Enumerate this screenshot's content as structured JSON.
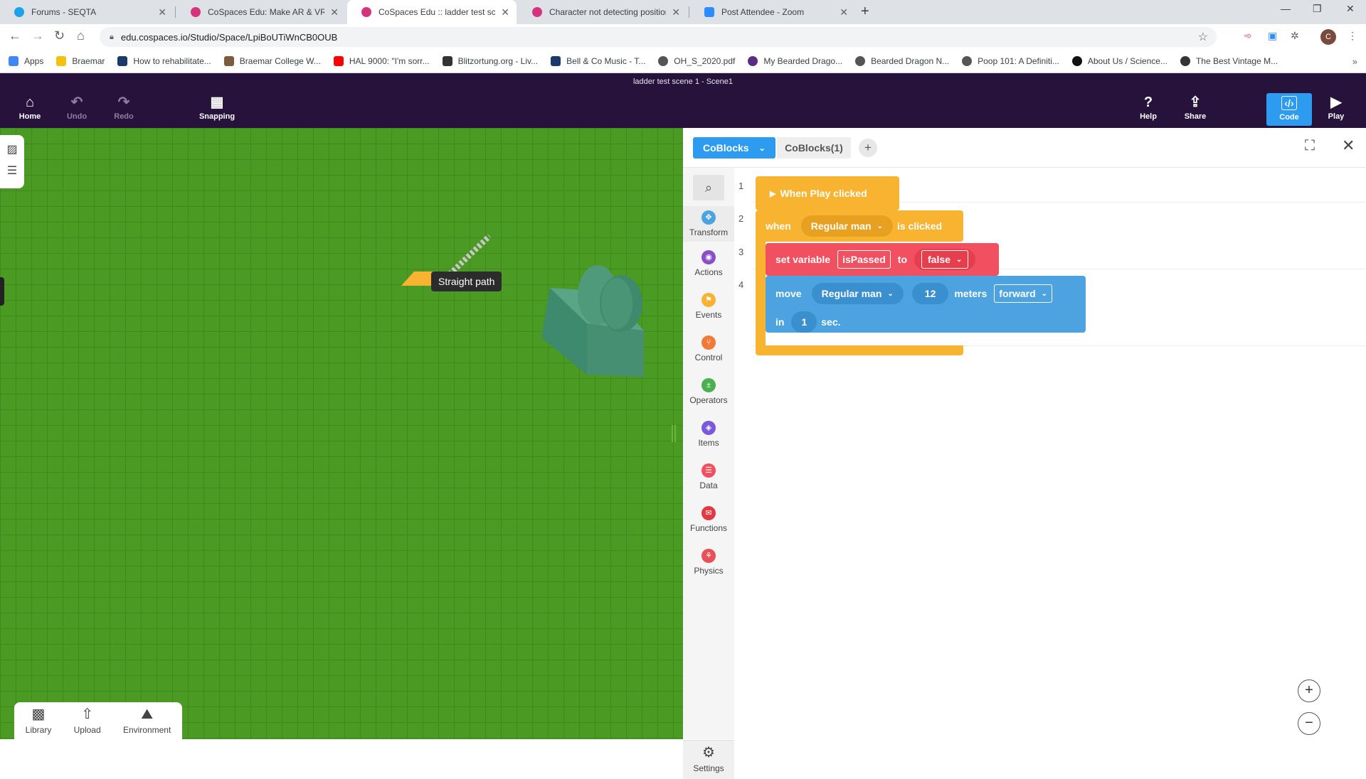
{
  "browser": {
    "tabs": [
      {
        "title": "Forums - SEQTA",
        "color": "#1aa3e8"
      },
      {
        "title": "CoSpaces Edu: Make AR & VR in",
        "color": "#d6337c"
      },
      {
        "title": "CoSpaces Edu :: ladder test scene",
        "color": "#d6337c"
      },
      {
        "title": "Character not detecting position",
        "color": "#d6337c"
      },
      {
        "title": "Post Attendee - Zoom",
        "color": "#2d8cff"
      }
    ],
    "url": "edu.cospaces.io/Studio/Space/LpiBoUTiWnCB0OUB",
    "avatar_letter": "C",
    "bookmarks": [
      {
        "label": "Apps",
        "color": "#4285f4"
      },
      {
        "label": "Braemar",
        "color": "#f4c20d"
      },
      {
        "label": "How to rehabilitate...",
        "color": "#1b3a6b"
      },
      {
        "label": "Braemar College W...",
        "color": "#7a5c3a"
      },
      {
        "label": "HAL 9000: \"I'm sorr...",
        "color": "#ff0000"
      },
      {
        "label": "Blitzortung.org - Liv...",
        "color": "#333333"
      },
      {
        "label": "Bell & Co Music - T...",
        "color": "#1b3a6b"
      },
      {
        "label": "OH_S_2020.pdf",
        "color": "#555555"
      },
      {
        "label": "My Bearded Drago...",
        "color": "#5a2d82"
      },
      {
        "label": "Bearded Dragon N...",
        "color": "#555555"
      },
      {
        "label": "Poop 101: A Definiti...",
        "color": "#555555"
      },
      {
        "label": "About Us / Science...",
        "color": "#111111"
      },
      {
        "label": "The Best Vintage M...",
        "color": "#333333"
      }
    ]
  },
  "header": {
    "title": "ladder test scene 1 - Scene1",
    "buttons": {
      "home": "Home",
      "undo": "Undo",
      "redo": "Redo",
      "snapping": "Snapping",
      "help": "Help",
      "share": "Share",
      "code": "Code",
      "play": "Play"
    }
  },
  "viewport": {
    "tooltip": "Straight path",
    "bottom_bar": {
      "library": "Library",
      "upload": "Upload",
      "environment": "Environment"
    }
  },
  "code_panel": {
    "tabs": {
      "active": "CoBlocks",
      "other": "CoBlocks(1)"
    },
    "palette": [
      {
        "label": "Transform",
        "color": "#4da3e0",
        "glyph": "✥"
      },
      {
        "label": "Actions",
        "color": "#8a4fc7",
        "glyph": "◉"
      },
      {
        "label": "Events",
        "color": "#f8b431",
        "glyph": "⚑"
      },
      {
        "label": "Control",
        "color": "#f07a3a",
        "glyph": "⑂"
      },
      {
        "label": "Operators",
        "color": "#4bb04f",
        "glyph": "±"
      },
      {
        "label": "Items",
        "color": "#7a5ad8",
        "glyph": "◈"
      },
      {
        "label": "Data",
        "color": "#f0505f",
        "glyph": "☰"
      },
      {
        "label": "Functions",
        "color": "#e23a45",
        "glyph": "✉"
      },
      {
        "label": "Physics",
        "color": "#e8505a",
        "glyph": "⚘"
      }
    ],
    "settings_label": "Settings",
    "line_numbers": [
      "1",
      "2",
      "3",
      "4"
    ],
    "blocks": {
      "event_play": "When Play clicked",
      "when": "when",
      "when_item": "Regular man",
      "is_clicked": "is clicked",
      "set_variable": "set variable",
      "variable_name": "isPassed",
      "to": "to",
      "variable_value": "false",
      "move": "move",
      "move_item": "Regular man",
      "move_distance": "12",
      "meters": "meters",
      "direction": "forward",
      "in": "in",
      "duration": "1",
      "sec": "sec."
    },
    "zoom_in": "+",
    "zoom_out": "−"
  }
}
